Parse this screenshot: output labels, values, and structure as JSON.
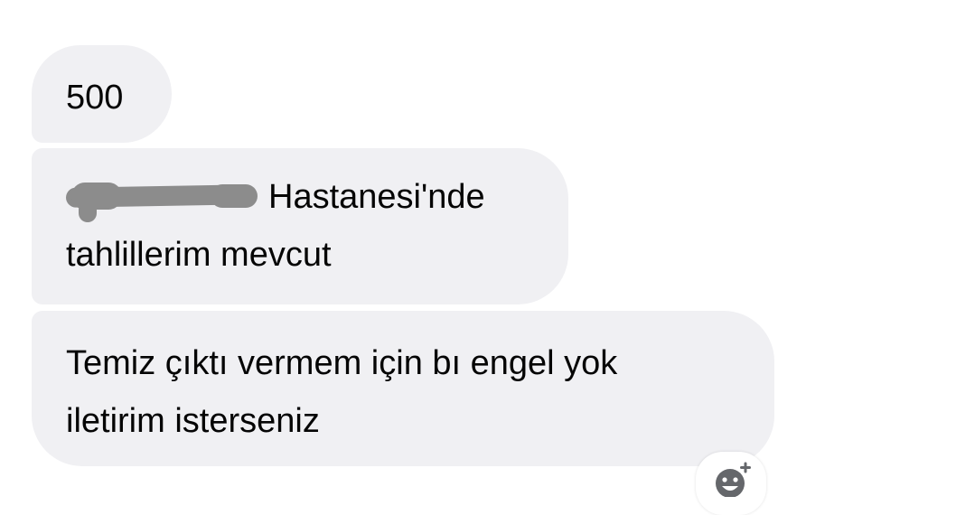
{
  "messages": [
    {
      "lines": [
        "500"
      ]
    },
    {
      "lines": [
        "Hastanesi'nde",
        "tahlillerim mevcut"
      ],
      "redacted_prefix": true
    },
    {
      "lines": [
        "Temiz çıktı vermem için bı engel yok",
        "iletirim isterseniz"
      ]
    }
  ],
  "reaction_button": {
    "icon": "add-reaction-icon"
  },
  "colors": {
    "bubble_bg": "#f0f0f3",
    "text": "#050505",
    "redaction": "#8c8c8c",
    "icon": "#65676b"
  }
}
